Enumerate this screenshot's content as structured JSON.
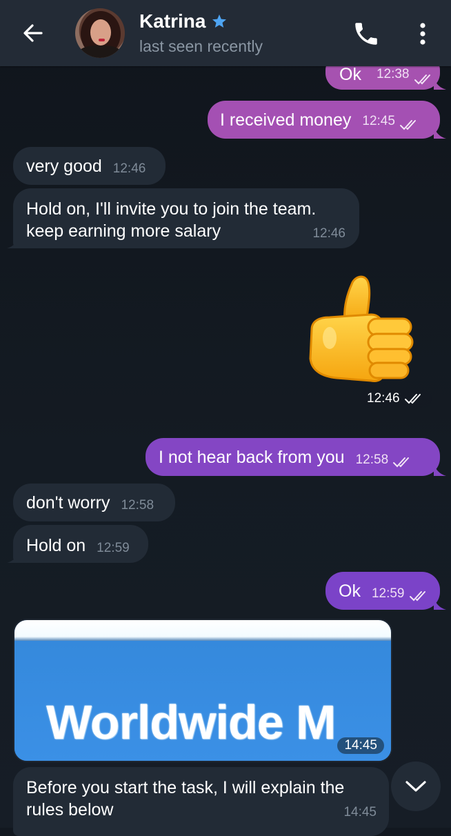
{
  "header": {
    "contact_name": "Katrina",
    "status": "last seen recently",
    "icons": {
      "back": "arrow-left-icon",
      "verified": "star-icon",
      "call": "phone-icon",
      "menu": "more-vertical-icon"
    }
  },
  "colors": {
    "outgoing_top": "#a652b0",
    "outgoing_mid": "#8a45c4",
    "outgoing_bottom": "#7b43c8",
    "incoming": "#222b36",
    "header": "#232b36",
    "background": "#121820",
    "verified_star": "#4ea4f2"
  },
  "messages": [
    {
      "direction": "out",
      "text": "Ok",
      "time": "12:38",
      "status": "read"
    },
    {
      "direction": "out",
      "text": "I received money",
      "time": "12:45",
      "status": "read"
    },
    {
      "direction": "in",
      "text": "very good",
      "time": "12:46"
    },
    {
      "direction": "in",
      "text": "Hold on, I'll invite you to join the team. keep earning more salary",
      "line1": "Hold on, I'll invite you to join the team.",
      "line2": "keep earning more salary",
      "time": "12:46"
    },
    {
      "direction": "out",
      "type": "sticker",
      "sticker": "thumbs-up",
      "time": "12:46",
      "status": "read"
    },
    {
      "direction": "out",
      "text": "I not hear back from you",
      "time": "12:58",
      "status": "read"
    },
    {
      "direction": "in",
      "text": "don't worry",
      "time": "12:58"
    },
    {
      "direction": "in",
      "text": "Hold on",
      "time": "12:59"
    },
    {
      "direction": "out",
      "text": "Ok",
      "time": "12:59",
      "status": "read"
    },
    {
      "direction": "in",
      "type": "photo",
      "photo_text": "Worldwide M",
      "time": "14:45"
    },
    {
      "direction": "in",
      "text": "Before you start the task, I will explain the rules below",
      "line1": "Before you start the task, I will explain the",
      "line2": "rules below",
      "time": "14:45"
    }
  ],
  "scroll_button": {
    "icon": "chevron-down-icon"
  }
}
